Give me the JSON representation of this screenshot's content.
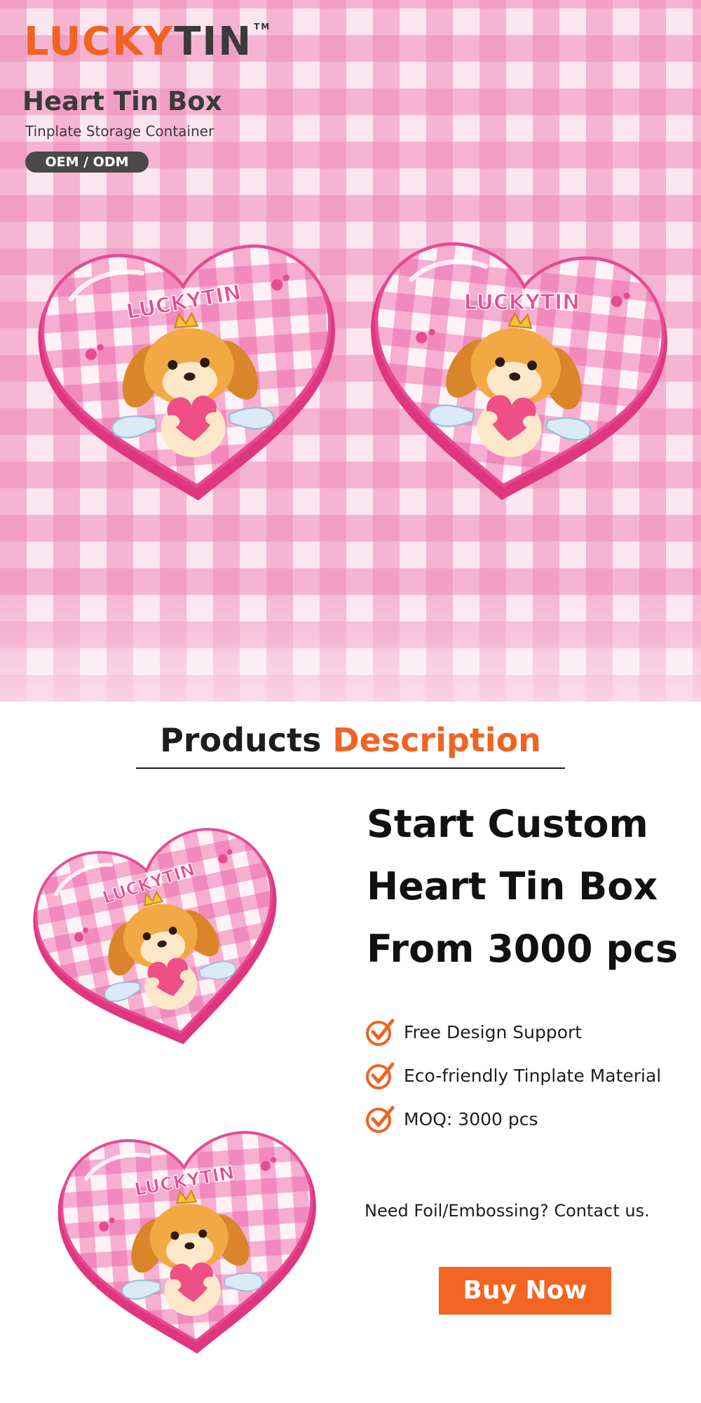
{
  "brand": {
    "logo_part1": "LUCKY",
    "logo_part2": "TIN",
    "trademark": "TM",
    "logo_color": "#f06322",
    "logo_dark_color": "#3a3a3a"
  },
  "hero": {
    "title": "Heart Tin Box",
    "subtitle": "Tinplate Storage Container",
    "badge": "OEM / ODM"
  },
  "product_image": {
    "lid_text": "LUCKYTIN",
    "pattern": "pink gingham",
    "illustration": "puppy-with-heart-icon"
  },
  "description": {
    "heading_part1": "Products ",
    "heading_part2": "Description",
    "accent_color": "#f06322",
    "headline_lines": [
      "Start Custom",
      "Heart Tin Box",
      "From 3000 pcs"
    ],
    "features": [
      {
        "icon": "check-icon",
        "label": "Free Design Support"
      },
      {
        "icon": "check-icon",
        "label": "Eco-friendly Tinplate Material"
      },
      {
        "icon": "check-icon",
        "label": "MOQ: 3000 pcs"
      }
    ],
    "contact_note": "Need Foil/Embossing? Contact us.",
    "buy_button": "Buy Now",
    "button_color": "#f26522"
  }
}
